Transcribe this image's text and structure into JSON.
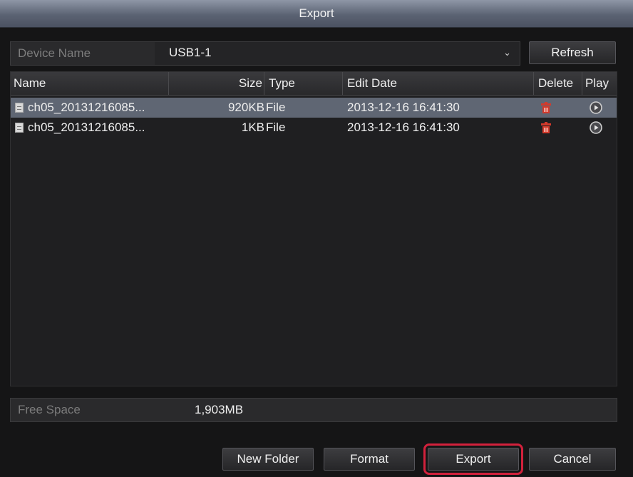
{
  "window": {
    "title": "Export"
  },
  "device": {
    "label": "Device Name",
    "selected": "USB1-1",
    "refresh_label": "Refresh"
  },
  "table": {
    "columns": {
      "name": "Name",
      "size": "Size",
      "type": "Type",
      "edit_date": "Edit Date",
      "delete": "Delete",
      "play": "Play"
    },
    "rows": [
      {
        "name": "ch05_20131216085...",
        "size": "920KB",
        "type": "File",
        "edit_date": "2013-12-16 16:41:30",
        "selected": true
      },
      {
        "name": "ch05_20131216085...",
        "size": "1KB",
        "type": "File",
        "edit_date": "2013-12-16 16:41:30",
        "selected": false
      }
    ]
  },
  "free_space": {
    "label": "Free Space",
    "value": "1,903MB"
  },
  "buttons": {
    "new_folder": "New Folder",
    "format": "Format",
    "export": "Export",
    "cancel": "Cancel"
  },
  "colors": {
    "title_bar": "#5b6373",
    "selected_row": "#5f6673",
    "delete_icon": "#d33a2c",
    "export_highlight": "#d2213c"
  },
  "icons": [
    "file-icon",
    "delete-icon",
    "play-icon",
    "chevron-down-icon"
  ]
}
